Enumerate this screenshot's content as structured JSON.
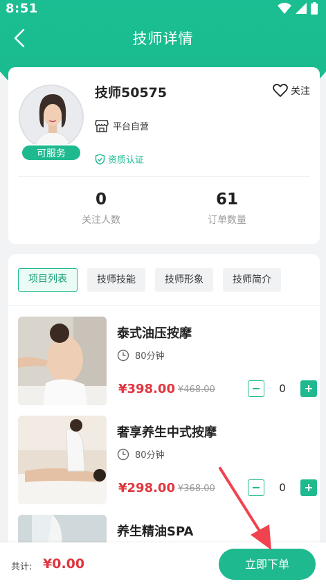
{
  "status_bar": {
    "time": "8:51"
  },
  "nav": {
    "title": "技师详情"
  },
  "profile": {
    "name": "技师50575",
    "follow_label": "关注",
    "service_badge": "可服务",
    "platform_label": "平台自营",
    "qualification_label": "资质认证",
    "stats": [
      {
        "value": "0",
        "label": "关注人数"
      },
      {
        "value": "61",
        "label": "订单数量"
      }
    ]
  },
  "tabs": [
    {
      "label": "项目列表",
      "active": true
    },
    {
      "label": "技师技能",
      "active": false
    },
    {
      "label": "技师形象",
      "active": false
    },
    {
      "label": "技师简介",
      "active": false
    }
  ],
  "items": [
    {
      "name": "泰式油压按摩",
      "duration": "80分钟",
      "price": "¥398.00",
      "original_price": "¥468.00",
      "quantity": "0"
    },
    {
      "name": "奢享养生中式按摩",
      "duration": "80分钟",
      "price": "¥298.00",
      "original_price": "¥368.00",
      "quantity": "0"
    },
    {
      "name": "养生精油SPA"
    }
  ],
  "bottom_bar": {
    "total_label": "共计:",
    "total_value": "¥0.00",
    "order_button": "立即下单"
  },
  "colors": {
    "brand_green": "#1fb98f",
    "price_red": "#e0363f",
    "annotation_arrow": "#f0434f"
  },
  "icons": [
    "wifi-icon",
    "signal-icon",
    "battery-icon",
    "back-icon",
    "heart-icon",
    "store-icon",
    "shield-check-icon",
    "clock-icon",
    "minus-icon",
    "plus-icon"
  ]
}
